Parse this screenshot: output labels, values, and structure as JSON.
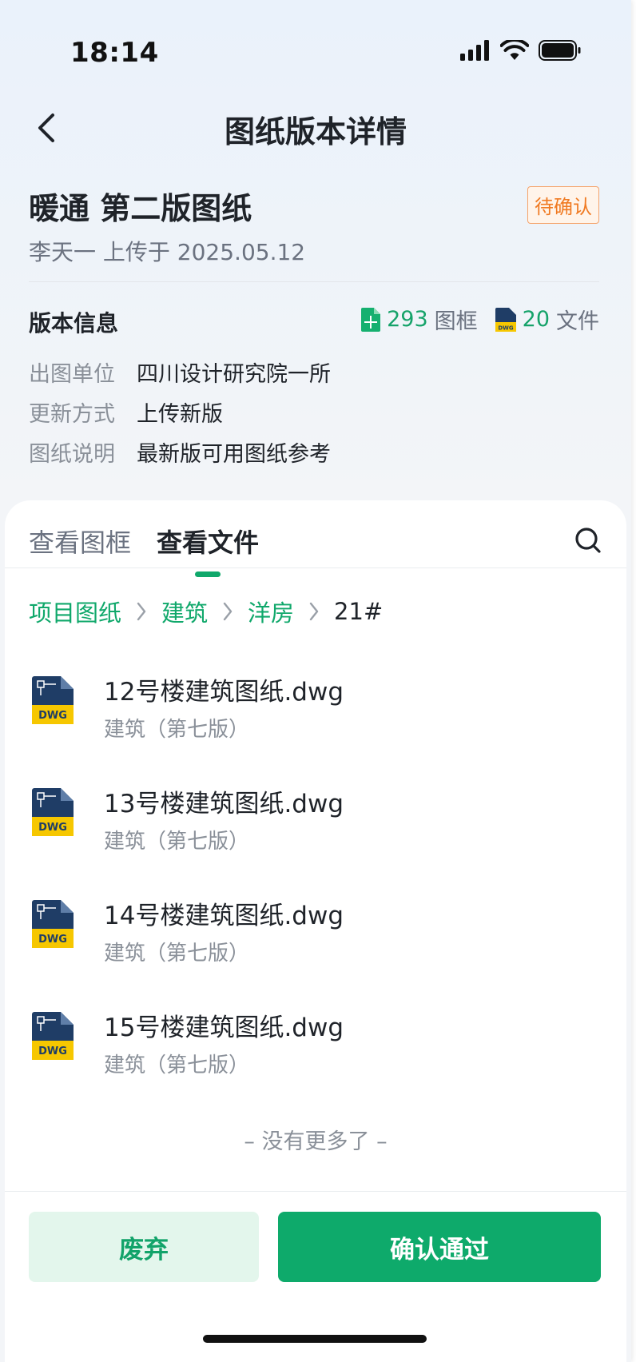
{
  "status_bar": {
    "time": "18:14"
  },
  "nav": {
    "title": "图纸版本详情"
  },
  "header": {
    "title": "暖通 第二版图纸",
    "badge": "待确认",
    "uploader": "李天一 上传于 2025.05.12"
  },
  "version_info": {
    "label": "版本信息",
    "frames_count": "293",
    "frames_label": "图框",
    "files_count": "20",
    "files_label": "文件",
    "fields": [
      {
        "key": "出图单位",
        "value": "四川设计研究院一所"
      },
      {
        "key": "更新方式",
        "value": "上传新版"
      },
      {
        "key": "图纸说明",
        "value": "最新版可用图纸参考"
      }
    ]
  },
  "tabs": [
    {
      "label": "查看图框",
      "active": false
    },
    {
      "label": "查看文件",
      "active": true
    }
  ],
  "breadcrumb": [
    "项目图纸",
    "建筑",
    "洋房",
    "21#"
  ],
  "files": [
    {
      "name": "12号楼建筑图纸.dwg",
      "sub": "建筑（第七版）",
      "icon": "dwg-file-icon"
    },
    {
      "name": "13号楼建筑图纸.dwg",
      "sub": "建筑（第七版）",
      "icon": "dwg-file-icon"
    },
    {
      "name": "14号楼建筑图纸.dwg",
      "sub": "建筑（第七版）",
      "icon": "dwg-file-icon"
    },
    {
      "name": "15号楼建筑图纸.dwg",
      "sub": "建筑（第七版）",
      "icon": "dwg-file-icon"
    }
  ],
  "no_more": "– 没有更多了 –",
  "actions": {
    "discard": "废弃",
    "confirm": "确认通过"
  },
  "colors": {
    "accent": "#0eaa6b",
    "pending": "#f07a22",
    "dwg_blue": "#1f3d66",
    "dwg_yellow": "#f6c700"
  }
}
